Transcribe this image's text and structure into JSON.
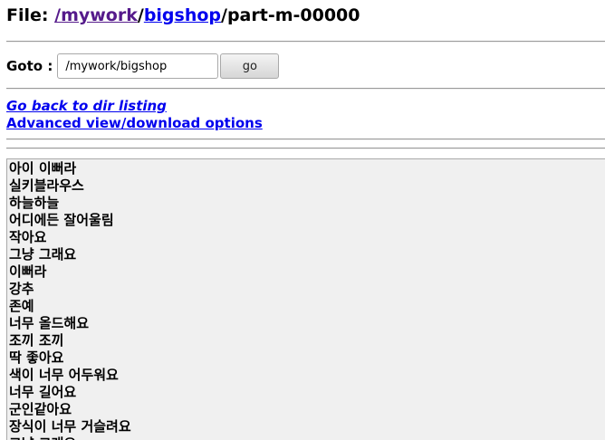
{
  "file": {
    "prefix": "File: ",
    "slash1": "/",
    "path1": "mywork",
    "slash2": "/",
    "path2": "bigshop",
    "rest": "/part-m-00000"
  },
  "goto": {
    "label": "Goto : ",
    "value": "/mywork/bigshop",
    "button": "go"
  },
  "links": {
    "back": "Go back to dir listing",
    "advanced": "Advanced view/download options"
  },
  "content": {
    "lines": [
      "아이 이뻐라",
      "실키블라우스",
      "하늘하늘",
      "어디에든 잘어울림",
      "작아요",
      "그냥 그래요",
      "이뻐라",
      "강추",
      "존예",
      "너무 올드해요",
      "조끼 조끼",
      "딱 좋아요",
      "색이 너무 어두워요",
      "너무 길어요",
      "군인같아요",
      "장식이 너무 거슬려요",
      "그냥 그래요"
    ]
  }
}
